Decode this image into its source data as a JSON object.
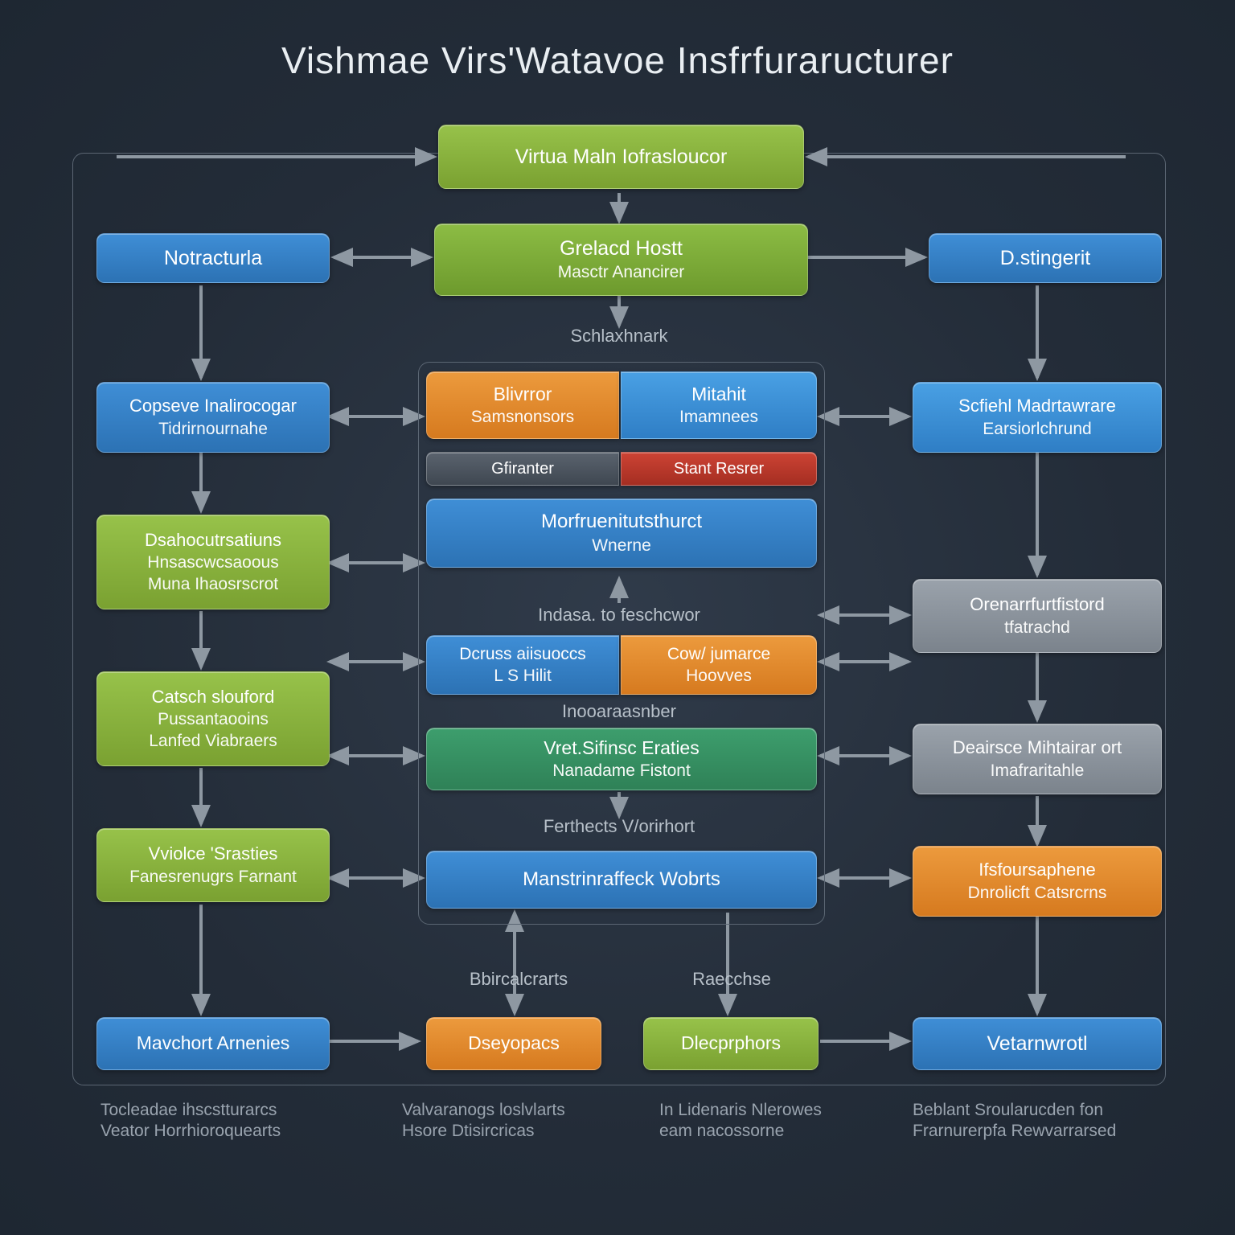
{
  "title": "Vishmae Virs'Watavoe Insfrfuraructurer",
  "top": {
    "main": "Virtua Maln Iofrasloucor",
    "host_l1": "Grelacd Hostt",
    "host_l2": "Masctr Anancirer",
    "under_host": "Schlaxhnark"
  },
  "left": {
    "l1": "Notracturla",
    "l2_l1": "Copseve Inalirocogar",
    "l2_l2": "Tidrirnournahe",
    "l3_l1": "Dsahocutrsatiuns",
    "l3_l2": "Hnsascwcsaoous",
    "l3_l3": "Muna Ihaosrscrot",
    "l4_l1": "Catsch slouford",
    "l4_l2": "Pussantaooins",
    "l4_l3": "Lanfed Viabraers",
    "l5_l1": "Vviolce 'Srasties",
    "l5_l2": "Fanesrenugrs Farnant",
    "l6": "Mavchort Arnenies"
  },
  "center": {
    "c1a_l1": "Blivrror",
    "c1a_l2": "Samsnonsors",
    "c1b_l1": "Mitahit",
    "c1b_l2": "Imamnees",
    "c2a": "Gfiranter",
    "c2b": "Stant Resrer",
    "c3_l1": "Morfruenitutsthurct",
    "c3_l2": "Wnerne",
    "c3_under": "Indasa. to feschcwor",
    "c4a_l1": "Dcruss aiisuoccs",
    "c4a_l2": "L S Hilit",
    "c4b_l1": "Cow/ jumarce",
    "c4b_l2": "Hoovves",
    "c4_under": "Inooaraasnber",
    "c5_l1": "Vret.Sifinsc Eraties",
    "c5_l2": "Nanadame Fistont",
    "c5_under": "Ferthects V/orirhort",
    "c6": "Manstrinraffeck Wobrts",
    "c7a": "Dseyopacs",
    "c7b": "Dlecprphors",
    "c7a_over": "Bbircalcrarts",
    "c7b_over": "Raecchse"
  },
  "right": {
    "r1": "D.stingerit",
    "r2_l1": "Scfiehl Madrtawrare",
    "r2_l2": "Earsiorlchrund",
    "r3_l1": "Orenarrfurtfistord",
    "r3_l2": "tfatrachd",
    "r4_l1": "Deairsce Mihtairar ort",
    "r4_l2": "Imafraritahle",
    "r5_l1": "Ifsfoursaphene",
    "r5_l2": "Dnrolicft Catsrcrns",
    "r6": "Vetarnwrotl"
  },
  "captions": {
    "a_l1": "Tocleadae ihscstturarcs",
    "a_l2": "Veator Horrhioroquearts",
    "b_l1": "Valvaranogs loslvlarts",
    "b_l2": "Hsore Dtisircricas",
    "c_l1": "In Lidenaris Nlerowes",
    "c_l2": "eam nacossorne",
    "d_l1": "Beblant Sroularucden fon",
    "d_l2": "Frarnurerpfa Rewvarrarsed"
  },
  "colors": {
    "green": "#86b23b",
    "blue": "#2f7cc0",
    "orange": "#e08a2e",
    "red": "#c2392b",
    "darkgrey": "#47505a",
    "grey": "#8a929c",
    "teal": "#3d9e6d"
  }
}
